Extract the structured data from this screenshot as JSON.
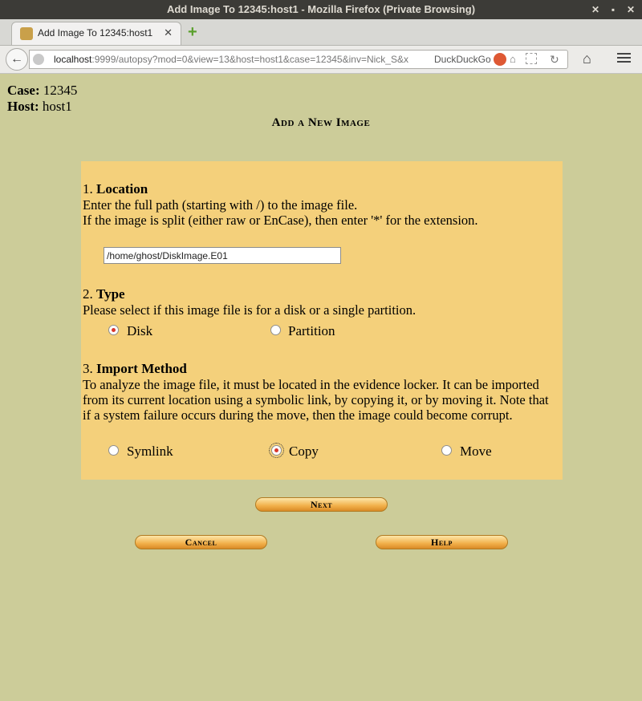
{
  "window": {
    "title": "Add Image To 12345:host1 - Mozilla Firefox (Private Browsing)",
    "buttons": [
      "✕",
      "▪",
      "✕"
    ]
  },
  "tab": {
    "title": "Add Image To 12345:host1",
    "close": "✕",
    "new_tab": "+"
  },
  "nav": {
    "url_host": "localhost",
    "url_rest": ":9999/autopsy?mod=0&view=13&host=host1&case=12345&inv=Nick_S&x",
    "search_engine": "DuckDuckGo"
  },
  "page": {
    "case_label": "Case:",
    "case_value": "12345",
    "host_label": "Host:",
    "host_value": "host1",
    "heading": "Add a New Image",
    "location": {
      "number": "1.",
      "title": "Location",
      "line1": "Enter the full path (starting with /) to the image file.",
      "line2": "If the image is split (either raw or EnCase), then enter '*' for the extension.",
      "path_value": "/home/ghost/DiskImage.E01"
    },
    "type": {
      "number": "2.",
      "title": "Type",
      "desc": "Please select if this image file is for a disk or a single partition.",
      "options": [
        "Disk",
        "Partition"
      ],
      "selected": "Disk"
    },
    "import": {
      "number": "3.",
      "title": "Import Method",
      "desc": "To analyze the image file, it must be located in the evidence locker. It can be imported from its current location using a symbolic link, by copying it, or by moving it. Note that if a system failure occurs during the move, then the image could become corrupt.",
      "options": [
        "Symlink",
        "Copy",
        "Move"
      ],
      "selected": "Copy"
    },
    "buttons": {
      "next": "Next",
      "cancel": "Cancel",
      "help": "Help"
    }
  }
}
